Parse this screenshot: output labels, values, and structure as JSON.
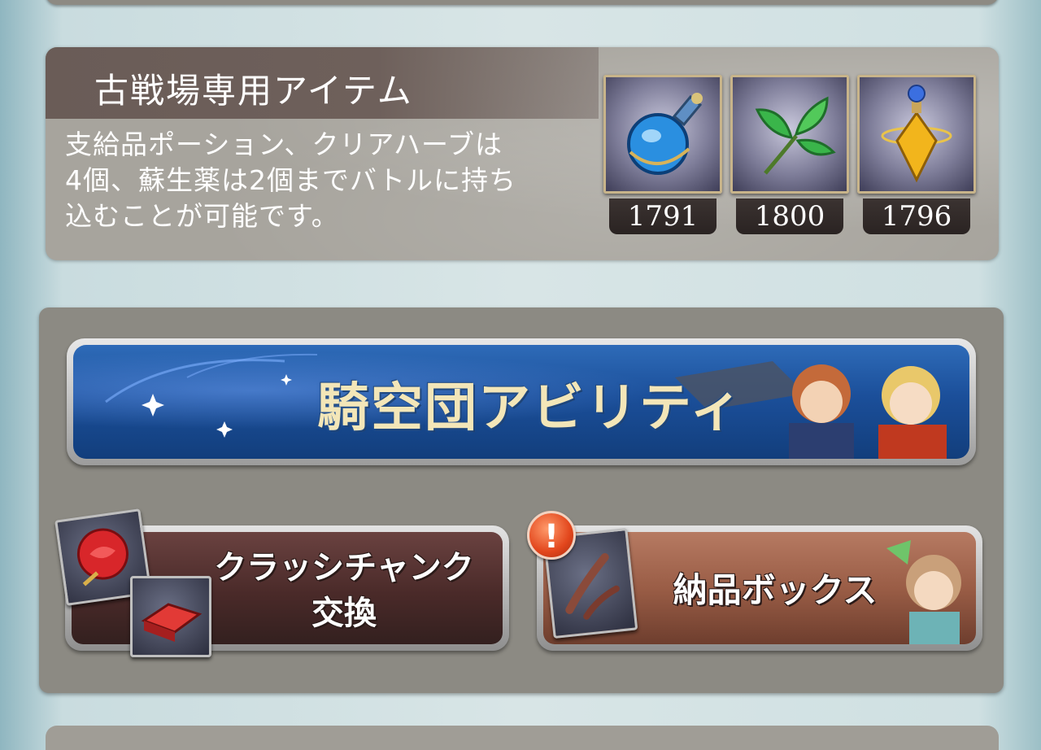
{
  "items_panel": {
    "title": "古戦場専用アイテム",
    "description_lines": [
      "支給品ポーション、クリアハーブは",
      "4個、蘇生薬は2個までバトルに持ち",
      "込むことが可能です。"
    ],
    "items": [
      {
        "icon": "blue-potion-icon",
        "count": "1791"
      },
      {
        "icon": "clear-herb-icon",
        "count": "1800"
      },
      {
        "icon": "revival-elixir-icon",
        "count": "1796"
      }
    ]
  },
  "menu": {
    "ability_banner_label": "騎空団アビリティ",
    "exchange_label_line1": "クラッシチャンク",
    "exchange_label_line2": "交換",
    "delivery_label": "納品ボックス",
    "alert_mark": "!"
  },
  "colors": {
    "panel_gray": "#a7a49d",
    "header_brown": "#6a5c57",
    "ability_blue": "#1b4f9a",
    "ability_text_gold": "#f3e6b8",
    "exchange_maroon": "#4a2a29",
    "delivery_copper": "#9a5d46",
    "alert_red": "#e2461c"
  }
}
